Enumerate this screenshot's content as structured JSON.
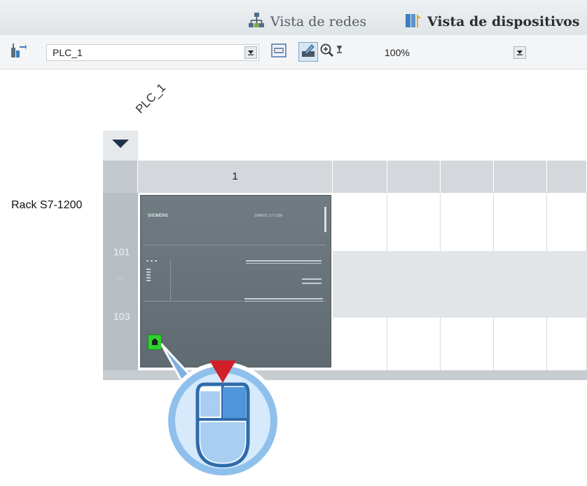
{
  "view_tabs": {
    "network_label": "Vista de redes",
    "device_label": "Vista de dispositivos"
  },
  "toolbar": {
    "device_select_value": "PLC_1",
    "zoom_value": "100%"
  },
  "rack": {
    "device_name": "PLC_1",
    "rack_label": "Rack S7-1200",
    "column_header": "1",
    "slot_start": "101",
    "slot_separator": "...",
    "slot_end": "103"
  },
  "plc_module": {
    "brand": "SIEMENS",
    "model": "SIMATIC S7-1200"
  },
  "colors": {
    "selection_green": "#2fd12f",
    "cursor_red": "#d11f2a",
    "cursor_blue": "#4f95d9"
  }
}
